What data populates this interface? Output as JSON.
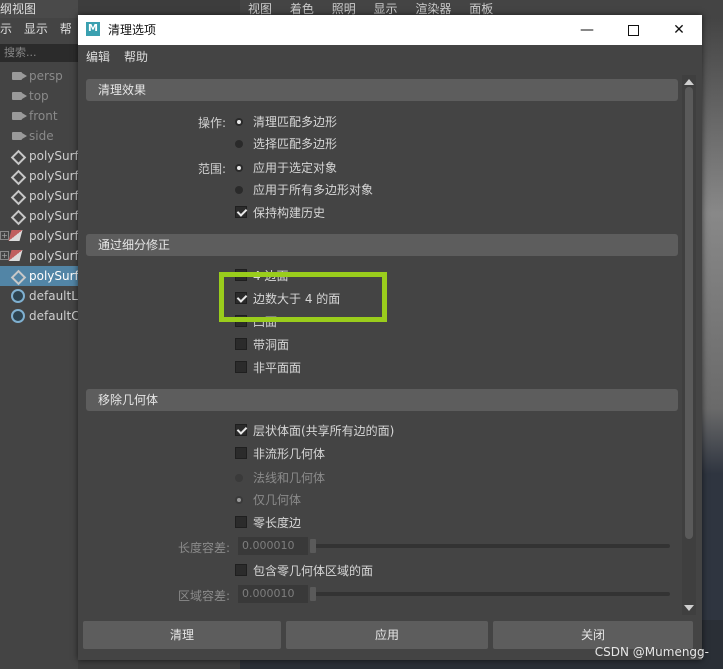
{
  "outliner": {
    "title": "纲视图",
    "menus": [
      "示",
      "显示",
      "帮"
    ],
    "search_placeholder": "搜索...",
    "items": [
      {
        "label": "persp",
        "kind": "camera"
      },
      {
        "label": "top",
        "kind": "camera"
      },
      {
        "label": "front",
        "kind": "camera"
      },
      {
        "label": "side",
        "kind": "camera"
      },
      {
        "label": "polySurf",
        "kind": "mesh"
      },
      {
        "label": "polySurf",
        "kind": "mesh"
      },
      {
        "label": "polySurf",
        "kind": "mesh"
      },
      {
        "label": "polySurf",
        "kind": "mesh"
      },
      {
        "label": "polySurf",
        "kind": "group"
      },
      {
        "label": "polySurf",
        "kind": "group"
      },
      {
        "label": "polySurf",
        "kind": "mesh",
        "selected": true
      },
      {
        "label": "defaultLi",
        "kind": "light"
      },
      {
        "label": "defaultC",
        "kind": "light"
      }
    ]
  },
  "viewport": {
    "menus": [
      "视图",
      "着色",
      "照明",
      "显示",
      "渲染器",
      "面板"
    ]
  },
  "dialog": {
    "title": "清理选项",
    "app_icon": "M",
    "window_controls": {
      "minimize": "—",
      "close": "✕"
    },
    "menus": [
      "编辑",
      "帮助"
    ],
    "sections": {
      "cleanup_effect": {
        "header": "清理效果",
        "operation_label": "操作:",
        "operation_options": [
          "清理匹配多边形",
          "选择匹配多边形"
        ],
        "operation_selected": 0,
        "scope_label": "范围:",
        "scope_options": [
          "应用于选定对象",
          "应用于所有多边形对象"
        ],
        "scope_selected": 0,
        "keep_history": {
          "label": "保持构建历史",
          "checked": true
        }
      },
      "subdivision_fix": {
        "header": "通过细分修正",
        "options": [
          {
            "label": "4 边面",
            "checked": false
          },
          {
            "label": "边数大于 4 的面",
            "checked": true
          },
          {
            "label": "凹面",
            "checked": false
          },
          {
            "label": "带洞面",
            "checked": false
          },
          {
            "label": "非平面面",
            "checked": false
          }
        ]
      },
      "remove_geometry": {
        "header": "移除几何体",
        "lamina": {
          "label": "层状体面(共享所有边的面)",
          "checked": true
        },
        "nonmanifold": {
          "label": "非流形几何体",
          "checked": false
        },
        "nonmanifold_options": [
          "法线和几何体",
          "仅几何体"
        ],
        "nonmanifold_selected": 1,
        "zero_edge": {
          "label": "零长度边",
          "checked": false
        },
        "length_tolerance_label": "长度容差:",
        "length_tolerance_value": "0.000010",
        "zero_area": {
          "label": "包含零几何体区域的面",
          "checked": false
        },
        "area_tolerance_label": "区域容差:",
        "area_tolerance_value": "0.000010"
      }
    },
    "buttons": {
      "cleanup": "清理",
      "apply": "应用",
      "close": "关闭"
    }
  },
  "watermark": "CSDN @Mumengg-",
  "colors": {
    "highlight_box": "#9acd1c",
    "selected_row": "#5285a6"
  }
}
